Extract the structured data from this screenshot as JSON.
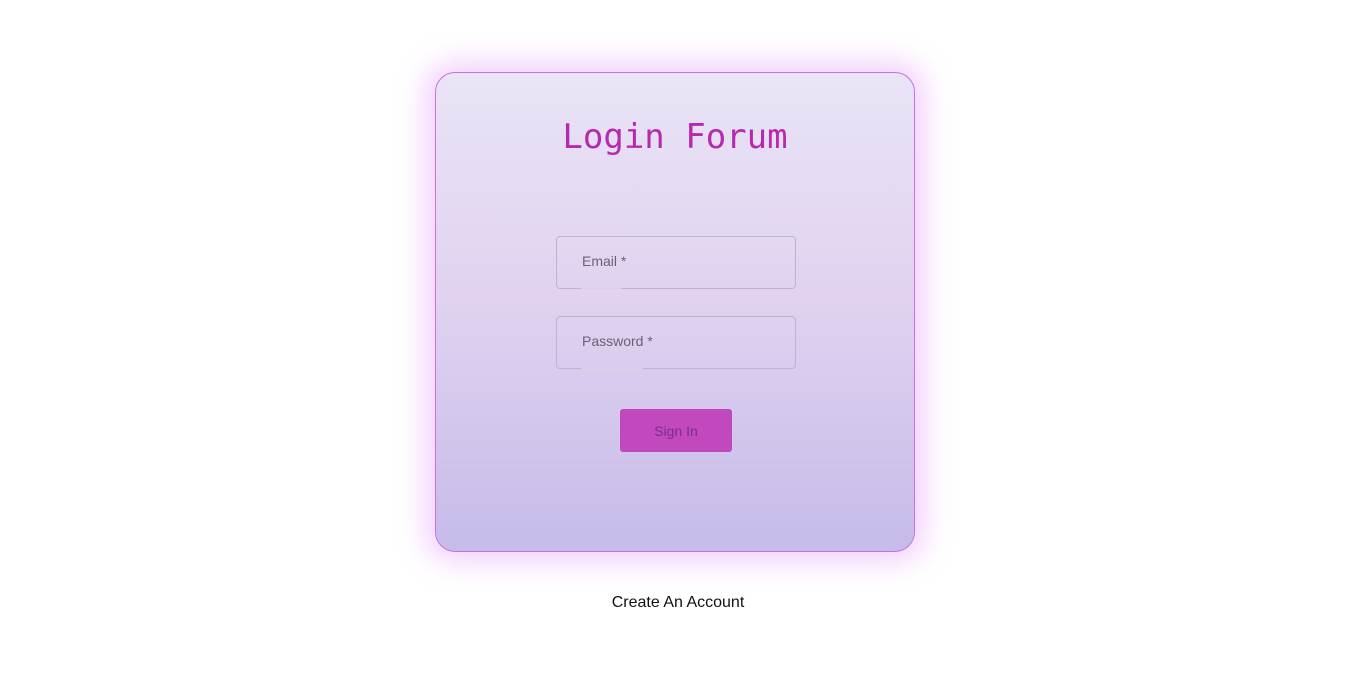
{
  "login": {
    "title": "Login Forum",
    "email_label": "Email *",
    "password_label": "Password *",
    "signin_label": "Sign In"
  },
  "footer": {
    "create_account_label": "Create An Account"
  },
  "colors": {
    "accent": "#b72aaf",
    "button": "#c248be",
    "card_border": "#c86ee8"
  }
}
